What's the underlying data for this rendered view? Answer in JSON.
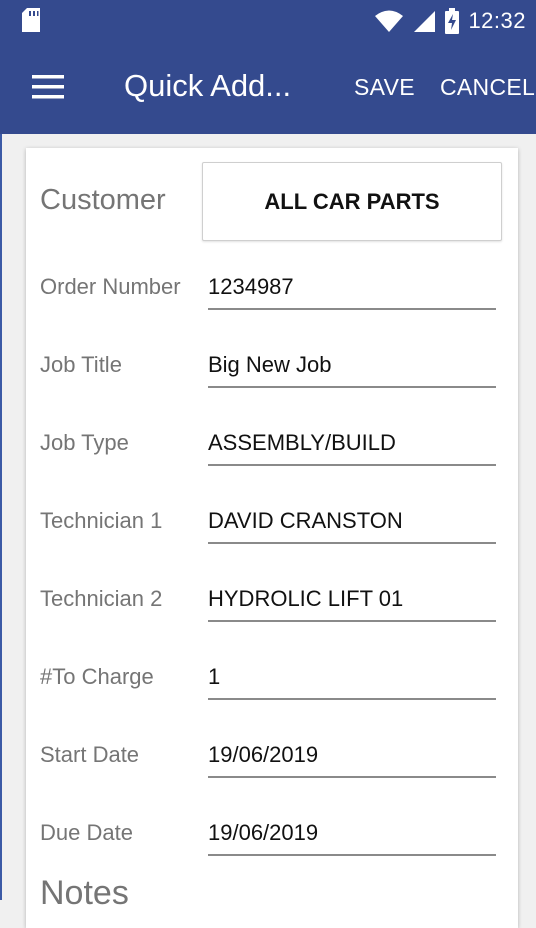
{
  "status_bar": {
    "time": "12:32",
    "icons": [
      "sd-card-icon",
      "wifi-icon",
      "cellular-signal-icon",
      "battery-charging-icon"
    ]
  },
  "app_bar": {
    "title": "Quick Add...",
    "save_label": "SAVE",
    "cancel_label": "CANCEL",
    "menu_icon": "hamburger-menu-icon"
  },
  "form": {
    "customer_label": "Customer",
    "customer_value": "ALL CAR PARTS",
    "fields": [
      {
        "label": "Order Number",
        "value": "1234987"
      },
      {
        "label": "Job Title",
        "value": "Big New Job"
      },
      {
        "label": "Job Type",
        "value": "ASSEMBLY/BUILD"
      },
      {
        "label": "Technician 1",
        "value": "DAVID CRANSTON"
      },
      {
        "label": "Technician 2",
        "value": "HYDROLIC LIFT 01"
      },
      {
        "label": "#To Charge",
        "value": "1"
      },
      {
        "label": "Start Date",
        "value": "19/06/2019"
      },
      {
        "label": "Due Date",
        "value": "19/06/2019"
      }
    ],
    "notes_label": "Notes"
  },
  "colors": {
    "primary": "#344a8e",
    "label_text": "#757575",
    "value_text": "#111111",
    "field_underline": "#8a8a8a"
  }
}
